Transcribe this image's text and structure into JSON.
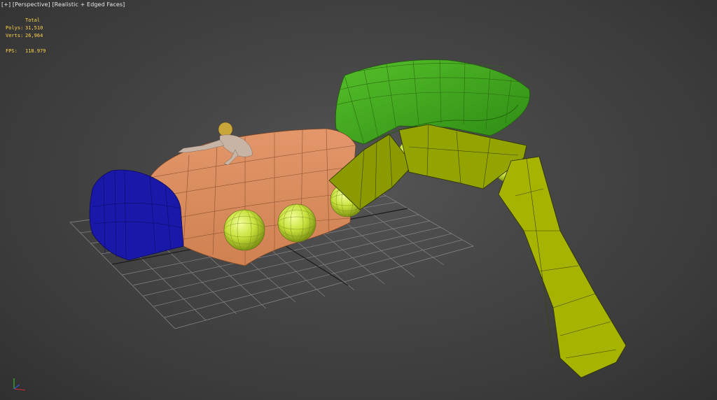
{
  "viewport": {
    "label_plus": "[+]",
    "label_view": "[Perspective]",
    "label_shading": "[Realistic + Edged Faces]"
  },
  "stats": {
    "header": "Total",
    "polys_label": "Polys:",
    "polys_value": "31,510",
    "verts_label": "Verts:",
    "verts_value": "26,964",
    "fps_label": "FPS:",
    "fps_value": "118.979"
  },
  "colors": {
    "grid": "#8a8a8a",
    "body": "#d8895a",
    "blue": "#1a18a8",
    "green": "#3fa820",
    "olive": "#9aa800",
    "sphere": "#d8f040",
    "stats_text": "#ffd34a"
  },
  "icons": {
    "axis_gizmo": "xyz-axis-icon"
  }
}
